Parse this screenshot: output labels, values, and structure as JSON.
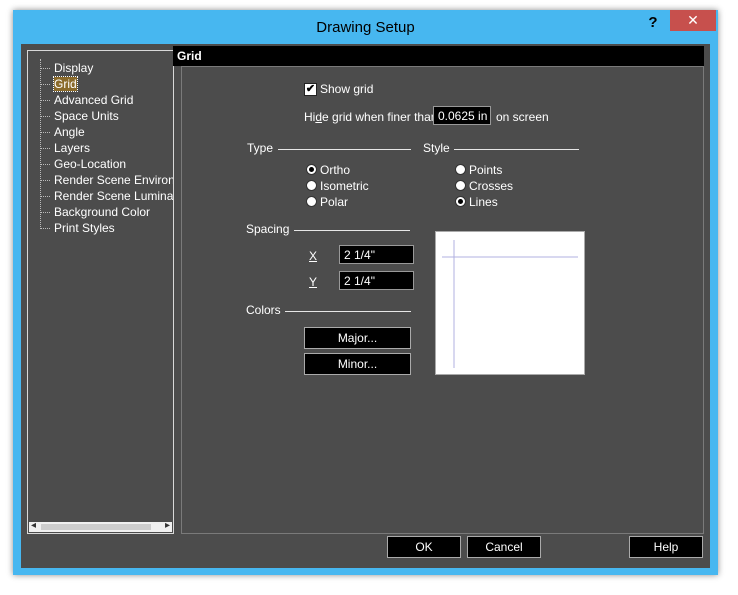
{
  "window": {
    "title": "Drawing Setup",
    "help_glyph": "?",
    "close_glyph": "✕"
  },
  "tree": {
    "items": [
      {
        "label": "Display"
      },
      {
        "label": "Grid"
      },
      {
        "label": "Advanced Grid"
      },
      {
        "label": "Space Units"
      },
      {
        "label": "Angle"
      },
      {
        "label": "Layers"
      },
      {
        "label": "Geo-Location"
      },
      {
        "label": "Render Scene Environ"
      },
      {
        "label": "Render Scene Luminar"
      },
      {
        "label": "Background Color"
      },
      {
        "label": "Print Styles"
      }
    ],
    "selected_index": 1,
    "scroll_left": "◂",
    "scroll_right": "▸"
  },
  "panel": {
    "header": "Grid",
    "show_grid": {
      "label": "Show grid",
      "checked": true,
      "mark": "✔"
    },
    "hide_grid": {
      "prefix": "Hi",
      "accel": "d",
      "rest": "e grid when finer than",
      "value": "0.0625 in",
      "suffix": "on screen"
    },
    "type": {
      "heading": "Type",
      "options": [
        "Ortho",
        "Isometric",
        "Polar"
      ],
      "selected": "Ortho"
    },
    "style": {
      "heading": "Style",
      "options": [
        "Points",
        "Crosses",
        "Lines"
      ],
      "selected": "Lines"
    },
    "spacing": {
      "heading": "Spacing",
      "x_label": "X",
      "x_value": "2 1/4\"",
      "y_label": "Y",
      "y_value": "2 1/4\""
    },
    "colors": {
      "heading": "Colors",
      "major_button": "Major...",
      "minor_button": "Minor..."
    }
  },
  "buttons": {
    "ok": "OK",
    "cancel": "Cancel",
    "help": "Help"
  },
  "colors": {
    "accent": "#47b7f0",
    "close": "#c7504d",
    "background": "#4c4c4c"
  }
}
